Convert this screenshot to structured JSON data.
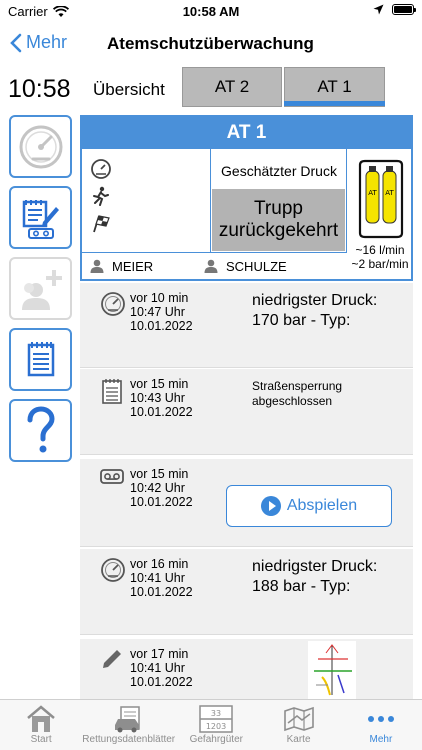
{
  "status_bar": {
    "carrier": "Carrier",
    "time": "10:58 AM"
  },
  "nav": {
    "back_label": "Mehr",
    "title": "Atemschutzüberwachung"
  },
  "clock": "10:58",
  "tabs": {
    "overview": "Übersicht",
    "at2": "AT 2",
    "at1": "AT 1",
    "selected": "AT 1"
  },
  "panel": {
    "title": "AT 1",
    "pressure_label": "Geschätzter Druck",
    "state_line1": "Trupp",
    "state_line2": "zurückgekehrt",
    "tank_label": "AT",
    "flow_rate": "~16 l/min",
    "pressure_rate": "~2 bar/min",
    "person1": "MEIER",
    "person2": "SCHULZE"
  },
  "log": [
    {
      "icon": "gauge-icon",
      "ago": "vor 10 min",
      "time": "10:47 Uhr",
      "date": "10.01.2022",
      "line1": "niedrigster Druck:",
      "line2": "170 bar - Typ:"
    },
    {
      "icon": "notepad-icon",
      "ago": "vor 15 min",
      "time": "10:43 Uhr",
      "date": "10.01.2022",
      "line1": "Straßensperrung",
      "line2": "abgeschlossen"
    },
    {
      "icon": "voicemail-icon",
      "ago": "vor 15 min",
      "time": "10:42 Uhr",
      "date": "10.01.2022",
      "button": "Abspielen"
    },
    {
      "icon": "gauge-icon",
      "ago": "vor 16 min",
      "time": "10:41 Uhr",
      "date": "10.01.2022",
      "line1": "niedrigster Druck:",
      "line2": "188 bar - Typ:"
    },
    {
      "icon": "pencil-icon",
      "ago": "vor 17 min",
      "time": "10:41 Uhr",
      "date": "10.01.2022"
    }
  ],
  "tabbar": {
    "start": "Start",
    "rescue": "Rettungsdatenblätter",
    "hazmat": "Gefahrgüter",
    "hazmat_top": "33",
    "hazmat_bottom": "1203",
    "map": "Karte",
    "more": "Mehr",
    "active": "Mehr"
  },
  "colors": {
    "accent": "#3a87d9",
    "panel_border": "#4a90d9",
    "tab_gray": "#b9b9b9",
    "state_gray": "#b3b3b3",
    "tank_yellow": "#f5e400"
  }
}
